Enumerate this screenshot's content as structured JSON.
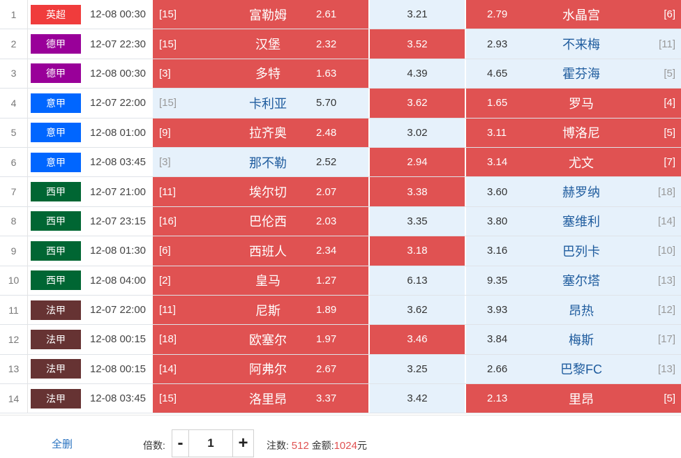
{
  "colors": {
    "selected": "#e05252",
    "unselected": "#e6f1fb",
    "team_text": "#1f5c9e",
    "league": {
      "英超": "#f03c3c",
      "德甲": "#990099",
      "意甲": "#0066ff",
      "西甲": "#006633",
      "法甲": "#663333"
    }
  },
  "matches": [
    {
      "num": "1",
      "league": "英超",
      "time": "12-08 00:30",
      "home_rank": "[15]",
      "home": "富勒姆",
      "home_odds": "2.61",
      "draw_odds": "3.21",
      "away_odds": "2.79",
      "away": "水晶宫",
      "away_rank": "[6]",
      "sel": [
        true,
        false,
        true
      ]
    },
    {
      "num": "2",
      "league": "德甲",
      "time": "12-07 22:30",
      "home_rank": "[15]",
      "home": "汉堡",
      "home_odds": "2.32",
      "draw_odds": "3.52",
      "away_odds": "2.93",
      "away": "不来梅",
      "away_rank": "[11]",
      "sel": [
        true,
        true,
        false
      ]
    },
    {
      "num": "3",
      "league": "德甲",
      "time": "12-08 00:30",
      "home_rank": "[3]",
      "home": "多特",
      "home_odds": "1.63",
      "draw_odds": "4.39",
      "away_odds": "4.65",
      "away": "霍芬海",
      "away_rank": "[5]",
      "sel": [
        true,
        false,
        false
      ]
    },
    {
      "num": "4",
      "league": "意甲",
      "time": "12-07 22:00",
      "home_rank": "[15]",
      "home": "卡利亚",
      "home_odds": "5.70",
      "draw_odds": "3.62",
      "away_odds": "1.65",
      "away": "罗马",
      "away_rank": "[4]",
      "sel": [
        false,
        true,
        true
      ]
    },
    {
      "num": "5",
      "league": "意甲",
      "time": "12-08 01:00",
      "home_rank": "[9]",
      "home": "拉齐奥",
      "home_odds": "2.48",
      "draw_odds": "3.02",
      "away_odds": "3.11",
      "away": "博洛尼",
      "away_rank": "[5]",
      "sel": [
        true,
        false,
        true
      ]
    },
    {
      "num": "6",
      "league": "意甲",
      "time": "12-08 03:45",
      "home_rank": "[3]",
      "home": "那不勒",
      "home_odds": "2.52",
      "draw_odds": "2.94",
      "away_odds": "3.14",
      "away": "尤文",
      "away_rank": "[7]",
      "sel": [
        false,
        true,
        true
      ]
    },
    {
      "num": "7",
      "league": "西甲",
      "time": "12-07 21:00",
      "home_rank": "[11]",
      "home": "埃尔切",
      "home_odds": "2.07",
      "draw_odds": "3.38",
      "away_odds": "3.60",
      "away": "赫罗纳",
      "away_rank": "[18]",
      "sel": [
        true,
        true,
        false
      ]
    },
    {
      "num": "8",
      "league": "西甲",
      "time": "12-07 23:15",
      "home_rank": "[16]",
      "home": "巴伦西",
      "home_odds": "2.03",
      "draw_odds": "3.35",
      "away_odds": "3.80",
      "away": "塞维利",
      "away_rank": "[14]",
      "sel": [
        true,
        false,
        false
      ]
    },
    {
      "num": "9",
      "league": "西甲",
      "time": "12-08 01:30",
      "home_rank": "[6]",
      "home": "西班人",
      "home_odds": "2.34",
      "draw_odds": "3.18",
      "away_odds": "3.16",
      "away": "巴列卡",
      "away_rank": "[10]",
      "sel": [
        true,
        true,
        false
      ]
    },
    {
      "num": "10",
      "league": "西甲",
      "time": "12-08 04:00",
      "home_rank": "[2]",
      "home": "皇马",
      "home_odds": "1.27",
      "draw_odds": "6.13",
      "away_odds": "9.35",
      "away": "塞尔塔",
      "away_rank": "[13]",
      "sel": [
        true,
        false,
        false
      ]
    },
    {
      "num": "11",
      "league": "法甲",
      "time": "12-07 22:00",
      "home_rank": "[11]",
      "home": "尼斯",
      "home_odds": "1.89",
      "draw_odds": "3.62",
      "away_odds": "3.93",
      "away": "昂热",
      "away_rank": "[12]",
      "sel": [
        true,
        false,
        false
      ]
    },
    {
      "num": "12",
      "league": "法甲",
      "time": "12-08 00:15",
      "home_rank": "[18]",
      "home": "欧塞尔",
      "home_odds": "1.97",
      "draw_odds": "3.46",
      "away_odds": "3.84",
      "away": "梅斯",
      "away_rank": "[17]",
      "sel": [
        true,
        true,
        false
      ]
    },
    {
      "num": "13",
      "league": "法甲",
      "time": "12-08 00:15",
      "home_rank": "[14]",
      "home": "阿弗尔",
      "home_odds": "2.67",
      "draw_odds": "3.25",
      "away_odds": "2.66",
      "away": "巴黎FC",
      "away_rank": "[13]",
      "sel": [
        true,
        false,
        false
      ]
    },
    {
      "num": "14",
      "league": "法甲",
      "time": "12-08 03:45",
      "home_rank": "[15]",
      "home": "洛里昂",
      "home_odds": "3.37",
      "draw_odds": "3.42",
      "away_odds": "2.13",
      "away": "里昂",
      "away_rank": "[5]",
      "sel": [
        true,
        false,
        true
      ]
    }
  ],
  "footer": {
    "clear_label": "全删",
    "multiplier_label": "倍数:",
    "minus": "-",
    "plus": "+",
    "multiplier_value": "1",
    "bets_label": "注数:",
    "bets_value": "512",
    "amount_label": "金额:",
    "amount_value": "1024",
    "currency": "元"
  }
}
